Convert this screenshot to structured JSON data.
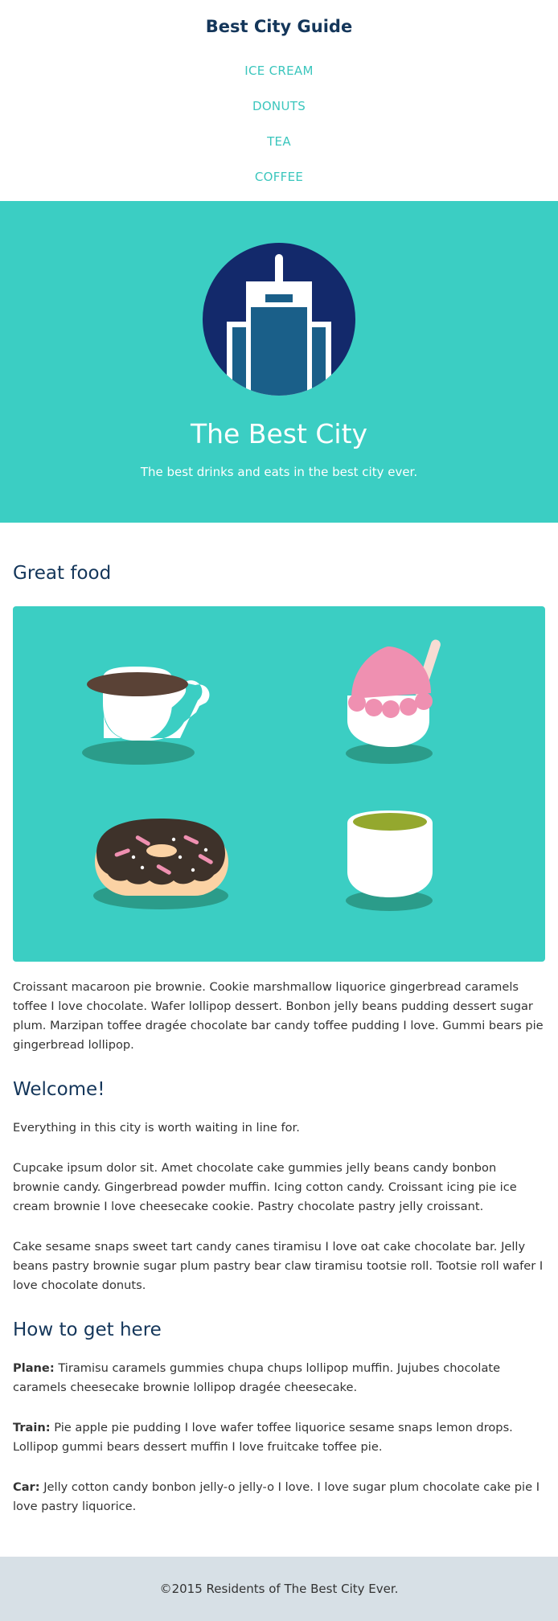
{
  "header": {
    "title": "Best City Guide",
    "nav": [
      "ICE CREAM",
      "DONUTS",
      "TEA",
      "COFFEE"
    ]
  },
  "hero": {
    "title": "The Best City",
    "tagline": "The best drinks and eats in the best city ever.",
    "logo_icon": "city-building-icon"
  },
  "sections": {
    "food": {
      "heading": "Great food",
      "image_icons": [
        "coffee-cup-icon",
        "ice-cream-icon",
        "donut-icon",
        "tea-cup-icon"
      ],
      "text": "Croissant macaroon pie brownie. Cookie marshmallow liquorice gingerbread caramels toffee I love chocolate. Wafer lollipop dessert. Bonbon jelly beans pudding dessert sugar plum. Marzipan toffee dragée chocolate bar candy toffee pudding I love. Gummi bears pie gingerbread lollipop."
    },
    "welcome": {
      "heading": "Welcome!",
      "p1": "Everything in this city is worth waiting in line for.",
      "p2": "Cupcake ipsum dolor sit. Amet chocolate cake gummies jelly beans candy bonbon brownie candy. Gingerbread powder muffin. Icing cotton candy. Croissant icing pie ice cream brownie I love cheesecake cookie. Pastry chocolate pastry jelly croissant.",
      "p3": "Cake sesame snaps sweet tart candy canes tiramisu I love oat cake chocolate bar. Jelly beans pastry brownie sugar plum pastry bear claw tiramisu tootsie roll. Tootsie roll wafer I love chocolate donuts."
    },
    "directions": {
      "heading": "How to get here",
      "plane_label": "Plane:",
      "plane_text": "Tiramisu caramels gummies chupa chups lollipop muffin. Jujubes chocolate caramels cheesecake brownie lollipop dragée cheesecake.",
      "train_label": "Train:",
      "train_text": "Pie apple pie pudding I love wafer toffee liquorice sesame snaps lemon drops. Lollipop gummi bears dessert muffin I love fruitcake toffee pie.",
      "car_label": "Car:",
      "car_text": "Jelly cotton candy bonbon jelly-o jelly-o I love. I love sugar plum chocolate cake pie I love pastry liquorice."
    }
  },
  "footer": {
    "text": "©2015 Residents of The Best City Ever."
  },
  "colors": {
    "teal": "#3bcec3",
    "navy": "#14365a",
    "link": "#3bc6bd",
    "footer_bg": "#d7e0e6"
  }
}
